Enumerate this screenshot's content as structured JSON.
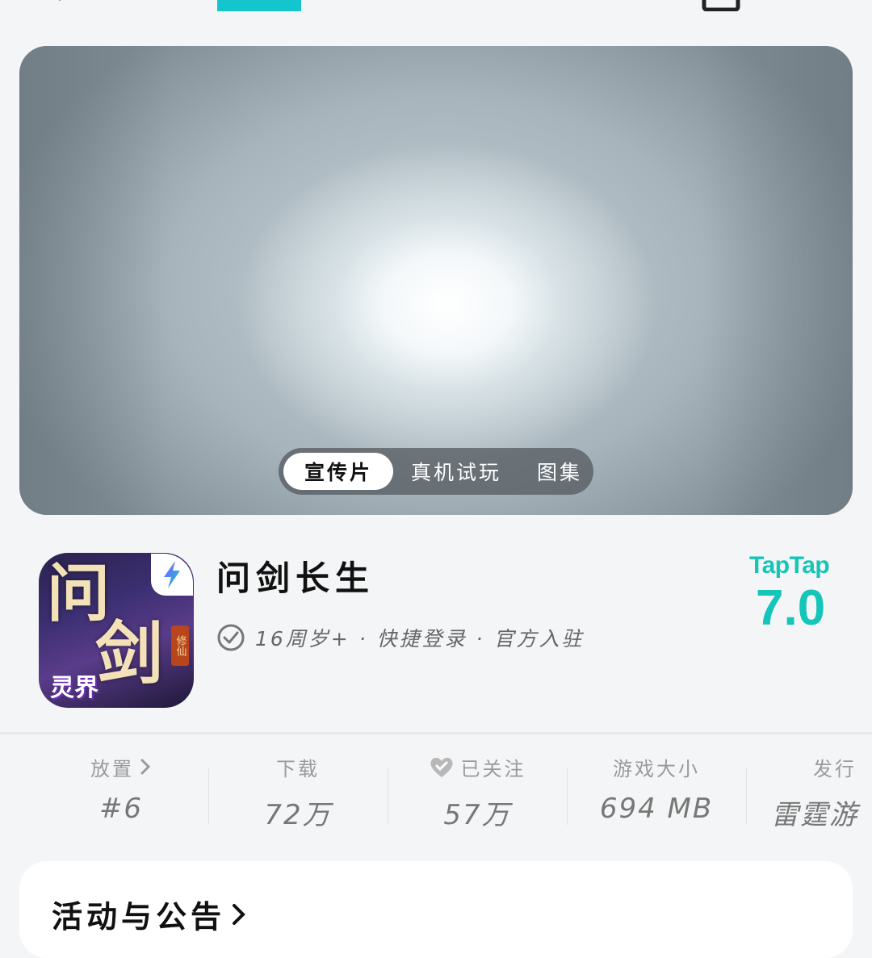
{
  "media_tabs": [
    "宣传片",
    "真机试玩",
    "图集"
  ],
  "game": {
    "title": "问剑长生",
    "icon_text_1": "问",
    "icon_text_2": "剑",
    "icon_sub": "灵界",
    "icon_seal": "修仙",
    "meta": "16周岁+ · 快捷登录 · 官方入驻"
  },
  "rating": {
    "brand": "TapTap",
    "score": "7.0"
  },
  "stats": [
    {
      "label": "放置",
      "value": "#6"
    },
    {
      "label": "下载",
      "value": "72万"
    },
    {
      "label": "已关注",
      "value": "57万"
    },
    {
      "label": "游戏大小",
      "value": "694 MB"
    },
    {
      "label": "发行",
      "value": "雷霆游"
    }
  ],
  "card": {
    "title": "活动与公告"
  },
  "colors": {
    "accent": "#15c5b8",
    "background": "#f4f5f6"
  },
  "icons": [
    "back-icon",
    "share-icon",
    "more-icon",
    "check-circle-icon",
    "heart-icon",
    "chevron-right-icon",
    "lightning-icon"
  ]
}
